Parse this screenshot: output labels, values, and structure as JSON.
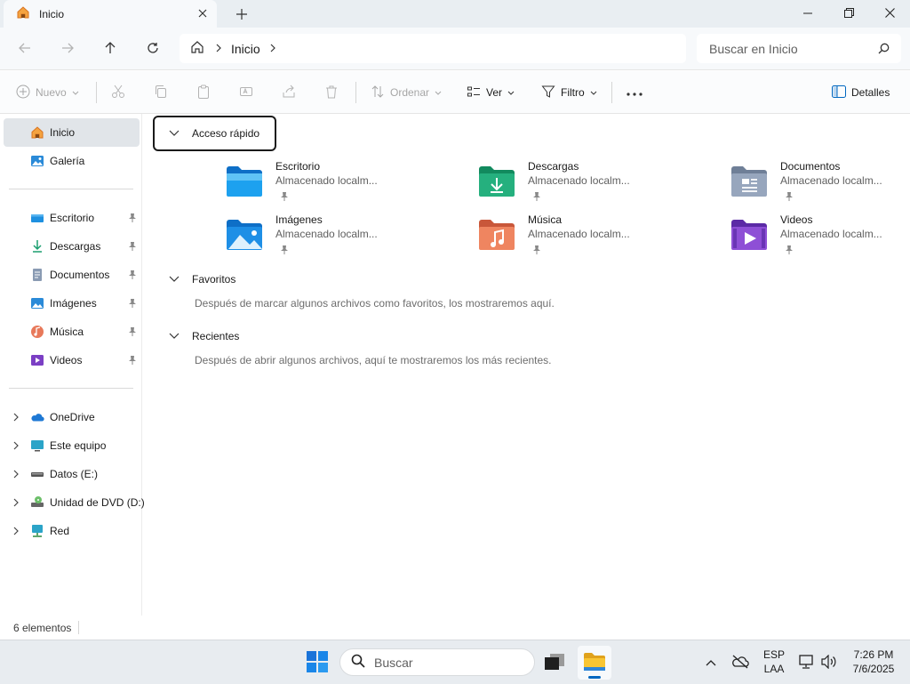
{
  "window": {
    "tab_title": "Inicio",
    "buttons": {
      "minimize": "minimize-icon",
      "maximize": "restore-icon",
      "close": "close-icon"
    }
  },
  "navbar": {
    "breadcrumb": [
      "Inicio"
    ],
    "search_placeholder": "Buscar en Inicio"
  },
  "commandbar": {
    "new_label": "Nuevo",
    "sort_label": "Ordenar",
    "view_label": "Ver",
    "filter_label": "Filtro",
    "details_label": "Detalles"
  },
  "sidebar": {
    "top": [
      {
        "label": "Inicio",
        "icon": "home-icon"
      },
      {
        "label": "Galería",
        "icon": "gallery-icon"
      }
    ],
    "pinned": [
      {
        "label": "Escritorio",
        "icon": "desktop-icon"
      },
      {
        "label": "Descargas",
        "icon": "downloads-icon"
      },
      {
        "label": "Documentos",
        "icon": "documents-icon"
      },
      {
        "label": "Imágenes",
        "icon": "pictures-icon"
      },
      {
        "label": "Música",
        "icon": "music-icon"
      },
      {
        "label": "Videos",
        "icon": "videos-icon"
      }
    ],
    "locations": [
      {
        "label": "OneDrive",
        "icon": "onedrive-icon"
      },
      {
        "label": "Este equipo",
        "icon": "this-pc-icon"
      },
      {
        "label": "Datos (E:)",
        "icon": "drive-icon"
      },
      {
        "label": "Unidad de DVD (D:)",
        "icon": "dvd-drive-icon"
      },
      {
        "label": "Red",
        "icon": "network-icon"
      }
    ]
  },
  "main": {
    "quick_access": {
      "title": "Acceso rápido",
      "items": [
        {
          "name": "Escritorio",
          "sub": "Almacenado localm...",
          "icon": "desktop-folder-icon"
        },
        {
          "name": "Descargas",
          "sub": "Almacenado localm...",
          "icon": "downloads-folder-icon"
        },
        {
          "name": "Documentos",
          "sub": "Almacenado localm...",
          "icon": "documents-folder-icon"
        },
        {
          "name": "Imágenes",
          "sub": "Almacenado localm...",
          "icon": "pictures-folder-icon"
        },
        {
          "name": "Música",
          "sub": "Almacenado localm...",
          "icon": "music-folder-icon"
        },
        {
          "name": "Videos",
          "sub": "Almacenado localm...",
          "icon": "videos-folder-icon"
        }
      ]
    },
    "favorites": {
      "title": "Favoritos",
      "empty": "Después de marcar algunos archivos como favoritos, los mostraremos aquí."
    },
    "recent": {
      "title": "Recientes",
      "empty": "Después de abrir algunos archivos, aquí te mostraremos los más recientes."
    }
  },
  "status": {
    "count": "6 elementos"
  },
  "taskbar": {
    "search_placeholder": "Buscar",
    "lang_line1": "ESP",
    "lang_line2": "LAA",
    "time": "7:26 PM",
    "date": "7/6/2025"
  },
  "colors": {
    "accent": "#0067c0",
    "selected": "#e1e5e9",
    "folder_blue": "#1e90e0"
  }
}
